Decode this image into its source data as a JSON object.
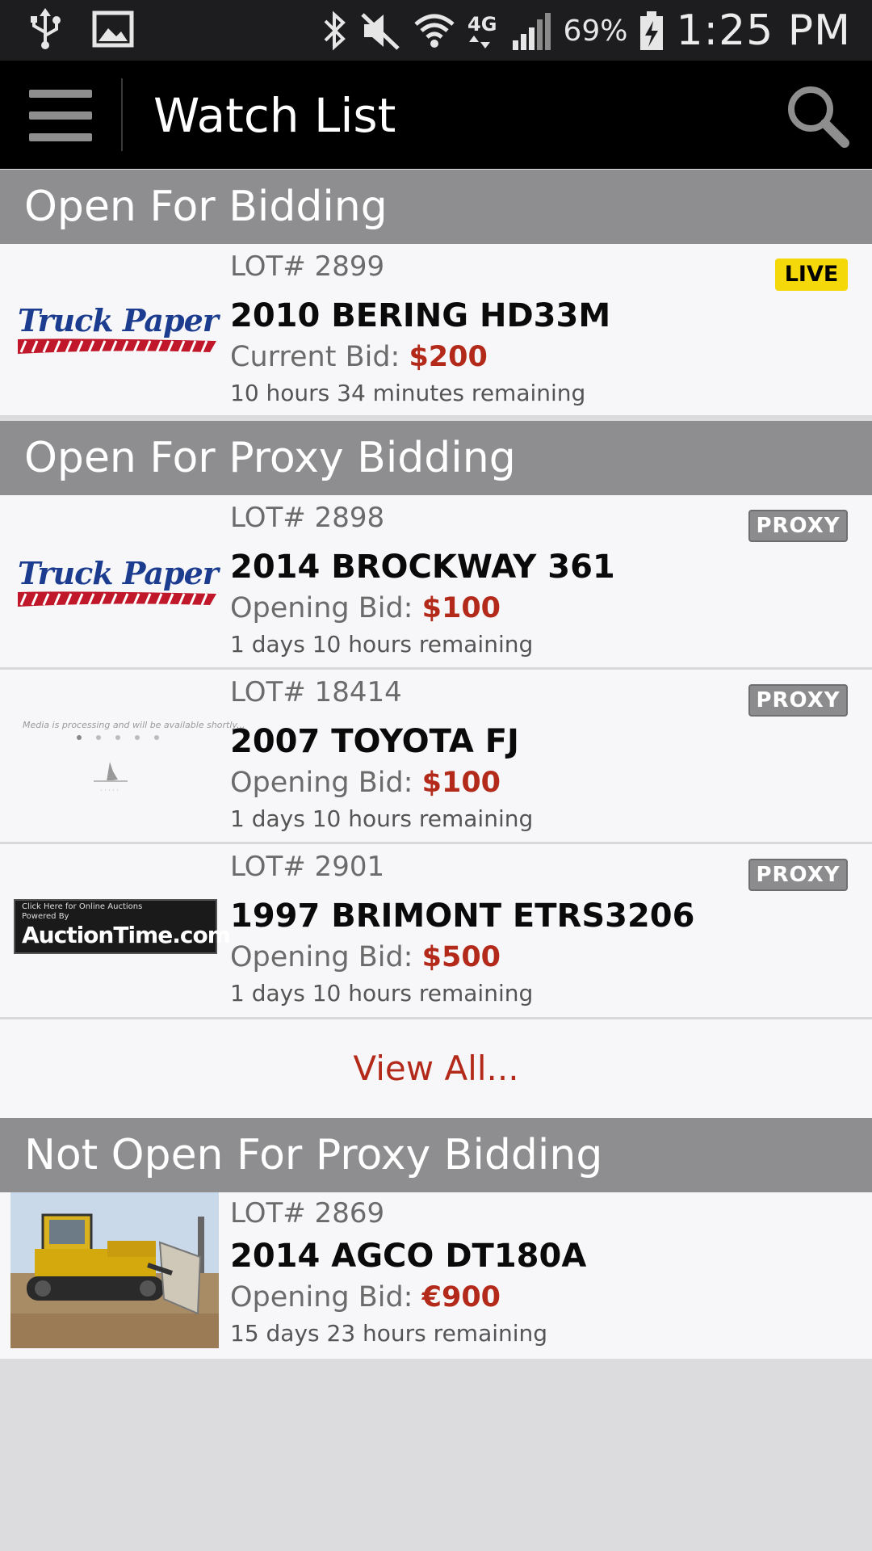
{
  "status_bar": {
    "battery_percent": "69%",
    "time": "1:25 PM",
    "network": "4G"
  },
  "action_bar": {
    "title": "Watch List"
  },
  "sections": {
    "open_for_bidding": {
      "title": "Open For Bidding",
      "lots": [
        {
          "lot": "LOT# 2899",
          "title": "2010 BERING HD33M",
          "bid_label": "Current Bid: ",
          "bid_amount": "$200",
          "remaining": "10 hours 34 minutes  remaining",
          "badge": "LIVE",
          "thumb": "Truck Paper"
        }
      ]
    },
    "open_for_proxy": {
      "title": "Open For Proxy Bidding",
      "lots": [
        {
          "lot": "LOT# 2898",
          "title": "2014 BROCKWAY 361",
          "bid_label": "Opening Bid: ",
          "bid_amount": "$100",
          "remaining": "1 days 10 hours  remaining",
          "badge": "PROXY",
          "thumb": "Truck Paper"
        },
        {
          "lot": "LOT# 18414",
          "title": "2007 TOYOTA FJ",
          "bid_label": "Opening Bid: ",
          "bid_amount": "$100",
          "remaining": "1 days 10 hours  remaining",
          "badge": "PROXY",
          "thumb_text": "Media is processing and will be available shortly..."
        },
        {
          "lot": "LOT# 2901",
          "title": "1997 BRIMONT ETRS3206",
          "bid_label": "Opening Bid: ",
          "bid_amount": "$500",
          "remaining": "1 days 10 hours  remaining",
          "badge": "PROXY",
          "thumb_line1": "Click Here for Online Auctions",
          "thumb_line2": "Powered By",
          "thumb_main": "AuctionTime.com"
        }
      ],
      "view_all": "View All..."
    },
    "not_open_for_proxy": {
      "title": "Not Open For Proxy Bidding",
      "lots": [
        {
          "lot": "LOT# 2869",
          "title": "2014 AGCO DT180A",
          "bid_label": "Opening Bid: ",
          "bid_amount": "€900",
          "remaining": "15 days 23 hours  remaining"
        }
      ]
    }
  },
  "colors": {
    "accent_red": "#b32a1a",
    "live_yellow": "#f5d80a",
    "section_gray": "#8e8e90"
  }
}
